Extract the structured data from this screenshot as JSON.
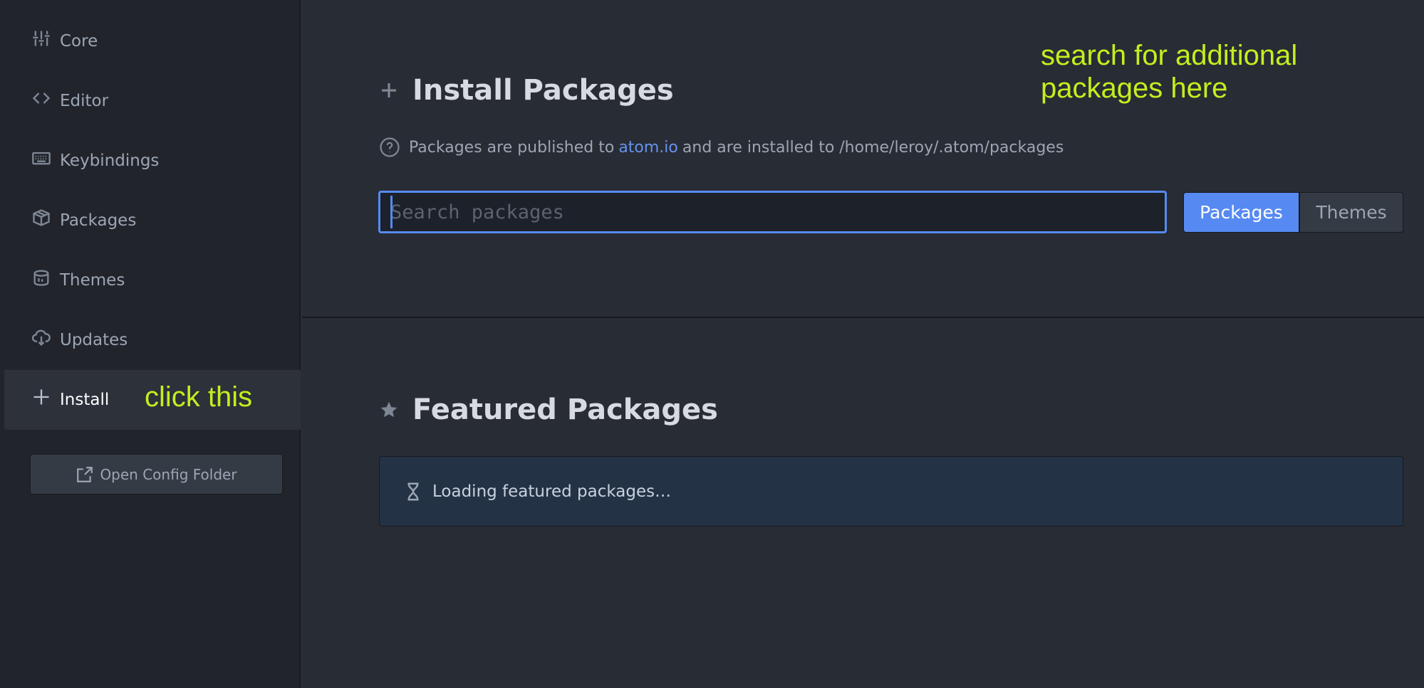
{
  "sidebar": {
    "items": [
      {
        "label": "Core",
        "icon": "sliders-icon"
      },
      {
        "label": "Editor",
        "icon": "code-icon"
      },
      {
        "label": "Keybindings",
        "icon": "keyboard-icon"
      },
      {
        "label": "Packages",
        "icon": "package-icon"
      },
      {
        "label": "Themes",
        "icon": "paintcan-icon"
      },
      {
        "label": "Updates",
        "icon": "cloud-download-icon"
      },
      {
        "label": "Install",
        "icon": "plus-icon",
        "active": true
      }
    ],
    "open_config_label": "Open Config Folder"
  },
  "install": {
    "title": "Install Packages",
    "info_prefix": "Packages are published to",
    "info_link": "atom.io",
    "info_suffix": "and are installed to /home/leroy/.atom/packages",
    "search_placeholder": "Search packages",
    "toggle_packages": "Packages",
    "toggle_themes": "Themes"
  },
  "featured": {
    "title": "Featured Packages",
    "loading_text": "Loading featured packages…"
  },
  "annotations": {
    "click_hint": "click this",
    "search_hint_line1": "search for additional",
    "search_hint_line2": "packages here"
  },
  "colors": {
    "accent": "#568af2",
    "annotation": "#c2ef1e",
    "background": "#282c34",
    "sidebar": "#21252b"
  }
}
